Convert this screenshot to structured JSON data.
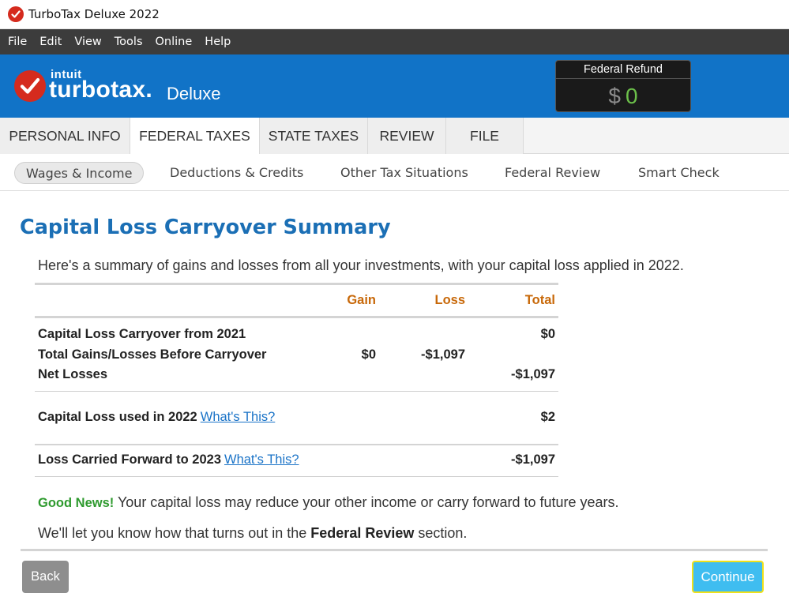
{
  "window": {
    "title": "TurboTax Deluxe 2022"
  },
  "menu": [
    "File",
    "Edit",
    "View",
    "Tools",
    "Online",
    "Help"
  ],
  "brand": {
    "intuit": "intuit",
    "product": "turbotax.",
    "edition": "Deluxe"
  },
  "refund": {
    "label": "Federal Refund",
    "currency": "$",
    "amount": "0"
  },
  "tabs": [
    {
      "label": "PERSONAL INFO",
      "active": false
    },
    {
      "label": "FEDERAL TAXES",
      "active": true
    },
    {
      "label": "STATE TAXES",
      "active": false
    },
    {
      "label": "REVIEW",
      "active": false
    },
    {
      "label": "FILE",
      "active": false
    }
  ],
  "subnav": [
    {
      "label": "Wages & Income",
      "active": true
    },
    {
      "label": "Deductions & Credits",
      "active": false
    },
    {
      "label": "Other Tax Situations",
      "active": false
    },
    {
      "label": "Federal Review",
      "active": false
    },
    {
      "label": "Smart Check",
      "active": false
    }
  ],
  "page": {
    "title": "Capital Loss Carryover Summary",
    "intro": "Here's a summary of gains and losses from all your investments, with your capital loss applied in 2022."
  },
  "table": {
    "headers": {
      "gain": "Gain",
      "loss": "Loss",
      "total": "Total"
    },
    "rows": [
      {
        "label": "Capital Loss Carryover from 2021",
        "gain": "",
        "loss": "",
        "total": "$0",
        "link": ""
      },
      {
        "label": "Total Gains/Losses Before Carryover",
        "gain": "$0",
        "loss": "-$1,097",
        "total": "",
        "link": ""
      },
      {
        "label": "Net Losses",
        "gain": "",
        "loss": "",
        "total": "-$1,097",
        "link": ""
      },
      {
        "label": "Capital Loss used in 2022",
        "gain": "",
        "loss": "",
        "total": "$2",
        "link": "What's This?"
      },
      {
        "label": "Loss Carried Forward to 2023",
        "gain": "",
        "loss": "",
        "total": "-$1,097",
        "link": "What's This?"
      }
    ]
  },
  "notes": {
    "good_news_label": "Good News!",
    "good_news_text": " Your capital loss may reduce your other income or carry forward to future years.",
    "review_prefix": "We'll let you know how that turns out in the ",
    "review_bold": "Federal Review",
    "review_suffix": " section."
  },
  "buttons": {
    "back": "Back",
    "continue": "Continue"
  }
}
